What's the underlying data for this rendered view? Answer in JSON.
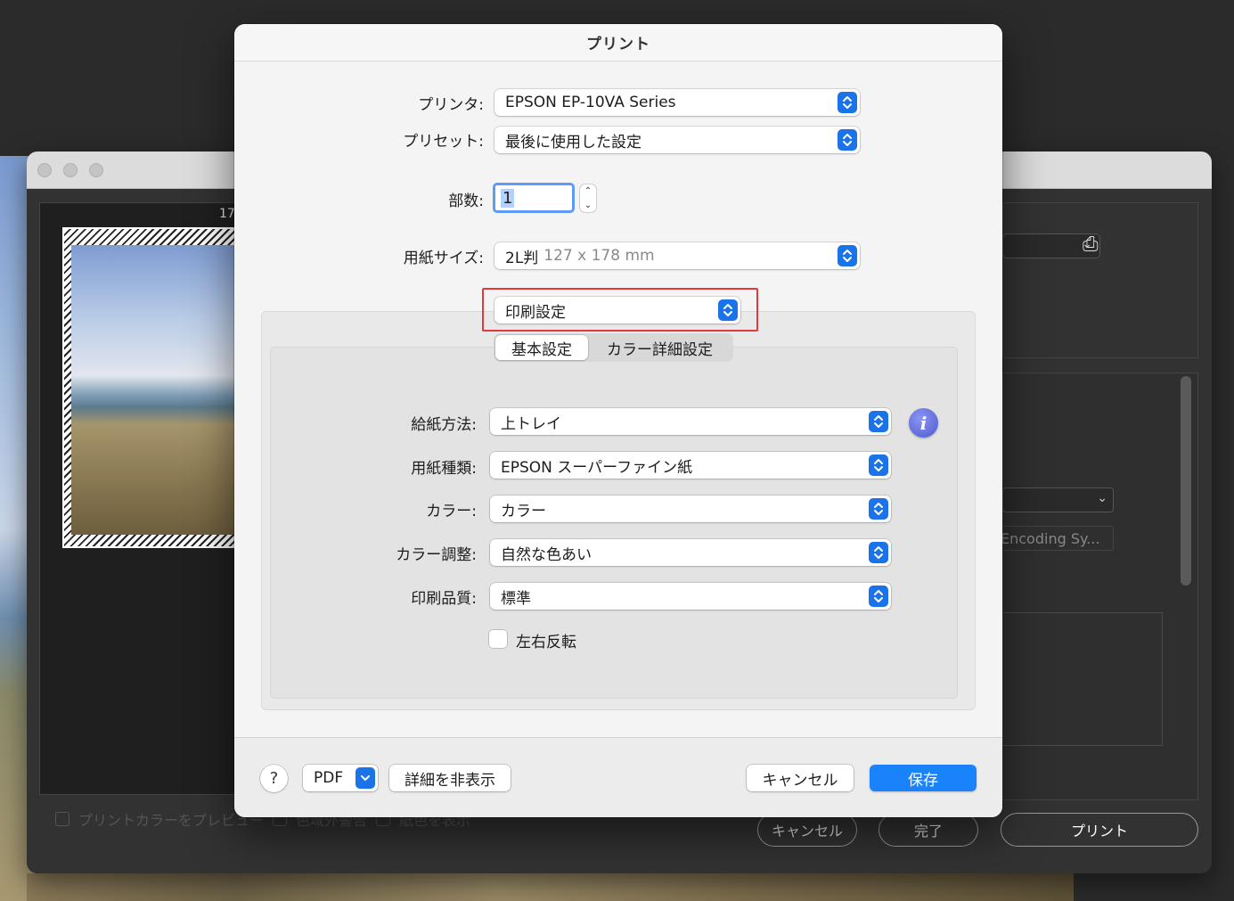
{
  "background": {
    "page_number": "17",
    "preview_checkbox_label": "プリントカラーをプレビュー",
    "gamut_warning_label": "色域外警告",
    "paper_color_label": "紙色を表示",
    "encoding_select": "Encoding Sy...",
    "buttons": {
      "cancel": "キャンセル",
      "done": "完了",
      "print": "プリント"
    }
  },
  "dialog": {
    "title": "プリント",
    "printer": {
      "label": "プリンタ:",
      "value": "EPSON EP-10VA Series"
    },
    "preset": {
      "label": "プリセット:",
      "value": "最後に使用した設定"
    },
    "copies": {
      "label": "部数:",
      "value": "1"
    },
    "paper_size": {
      "label": "用紙サイズ:",
      "value": "2L判",
      "detail": "127 x 178 mm"
    },
    "section_popup": {
      "value": "印刷設定"
    },
    "tabs": [
      {
        "label": "基本設定",
        "active": true
      },
      {
        "label": "カラー詳細設定",
        "active": false
      }
    ],
    "settings": {
      "paper_source": {
        "label": "給紙方法:",
        "value": "上トレイ"
      },
      "media_type": {
        "label": "用紙種類:",
        "value": "EPSON スーパーファイン紙"
      },
      "color": {
        "label": "カラー:",
        "value": "カラー"
      },
      "color_adjust": {
        "label": "カラー調整:",
        "value": "自然な色あい"
      },
      "print_quality": {
        "label": "印刷品質:",
        "value": "標準"
      },
      "mirror": {
        "label": "左右反転",
        "checked": false
      }
    },
    "footer": {
      "help": "?",
      "pdf": "PDF",
      "hide_details": "詳細を非表示",
      "cancel": "キャンセル",
      "save": "保存"
    }
  },
  "colors": {
    "accent": "#1a73e8",
    "primary_button": "#1a82fb",
    "highlight_box": "#e0393e",
    "info_icon": "#5a66dd"
  },
  "icons": [
    "popup-stepper-icon",
    "info-icon",
    "printer-add-icon",
    "chevron-down-icon",
    "help-icon"
  ]
}
